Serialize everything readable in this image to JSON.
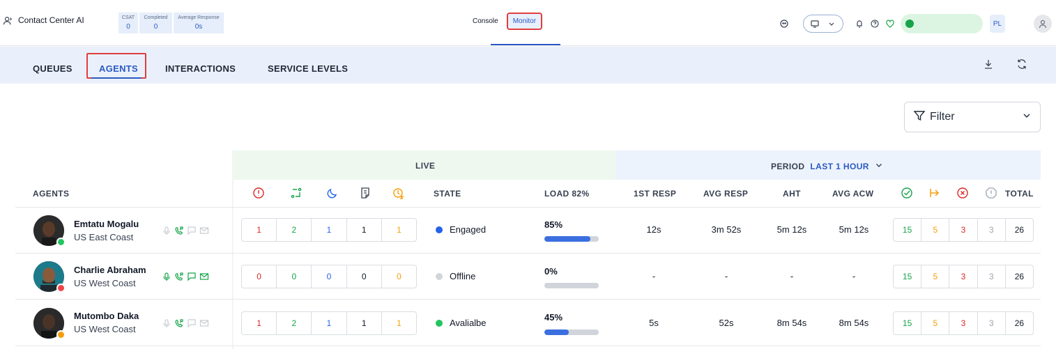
{
  "app": {
    "title": "Contact Center AI"
  },
  "stats": [
    {
      "label": "CSAT",
      "value": "0"
    },
    {
      "label": "Completed",
      "value": "0"
    },
    {
      "label": "Average Response",
      "value": "0s"
    }
  ],
  "top_tabs": [
    {
      "label": "Console",
      "active": false
    },
    {
      "label": "Monitor",
      "active": true
    }
  ],
  "user": {
    "initials": "PL"
  },
  "sub_tabs": [
    {
      "label": "QUEUES",
      "active": false
    },
    {
      "label": "AGENTS",
      "active": true
    },
    {
      "label": "INTERACTIONS",
      "active": false
    },
    {
      "label": "SERVICE LEVELS",
      "active": false
    }
  ],
  "filter": {
    "label": "Filter"
  },
  "table": {
    "live_label": "LIVE",
    "period_label": "PERIOD",
    "period_range": "LAST 1 HOUR",
    "columns": {
      "agents": "AGENTS",
      "state": "STATE",
      "load": "LOAD 82%",
      "first_resp": "1ST RESP",
      "avg_resp": "AVG RESP",
      "aht": "AHT",
      "avg_acw": "AVG ACW",
      "total": "TOTAL"
    },
    "rows": [
      {
        "name": "Emtatu Mogalu",
        "location": "US East Coast",
        "presence_color": "#22c55e",
        "live": [
          "1",
          "2",
          "1",
          "1",
          "1"
        ],
        "state": "Engaged",
        "state_color": "#2563eb",
        "load_text": "85%",
        "load": 0.85,
        "first_resp": "12s",
        "avg_resp": "3m 52s",
        "aht": "5m 12s",
        "avg_acw": "5m 12s",
        "period": [
          "15",
          "5",
          "3",
          "3",
          "26"
        ]
      },
      {
        "name": "Charlie Abraham",
        "location": "US West Coast",
        "presence_color": "#ef4444",
        "live": [
          "0",
          "0",
          "0",
          "0",
          "0"
        ],
        "state": "Offline",
        "state_color": "#d1d5db",
        "load_text": "0%",
        "load": 0,
        "first_resp": "-",
        "avg_resp": "-",
        "aht": "-",
        "avg_acw": "-",
        "period": [
          "15",
          "5",
          "3",
          "3",
          "26"
        ]
      },
      {
        "name": "Mutombo Daka",
        "location": "US West Coast",
        "presence_color": "#f59e0b",
        "live": [
          "1",
          "2",
          "1",
          "1",
          "1"
        ],
        "state": "Avalialbe",
        "state_color": "#22c55e",
        "load_text": "45%",
        "load": 0.45,
        "first_resp": "5s",
        "avg_resp": "52s",
        "aht": "8m 54s",
        "avg_acw": "8m 54s",
        "period": [
          "15",
          "5",
          "3",
          "3",
          "26"
        ]
      }
    ]
  }
}
